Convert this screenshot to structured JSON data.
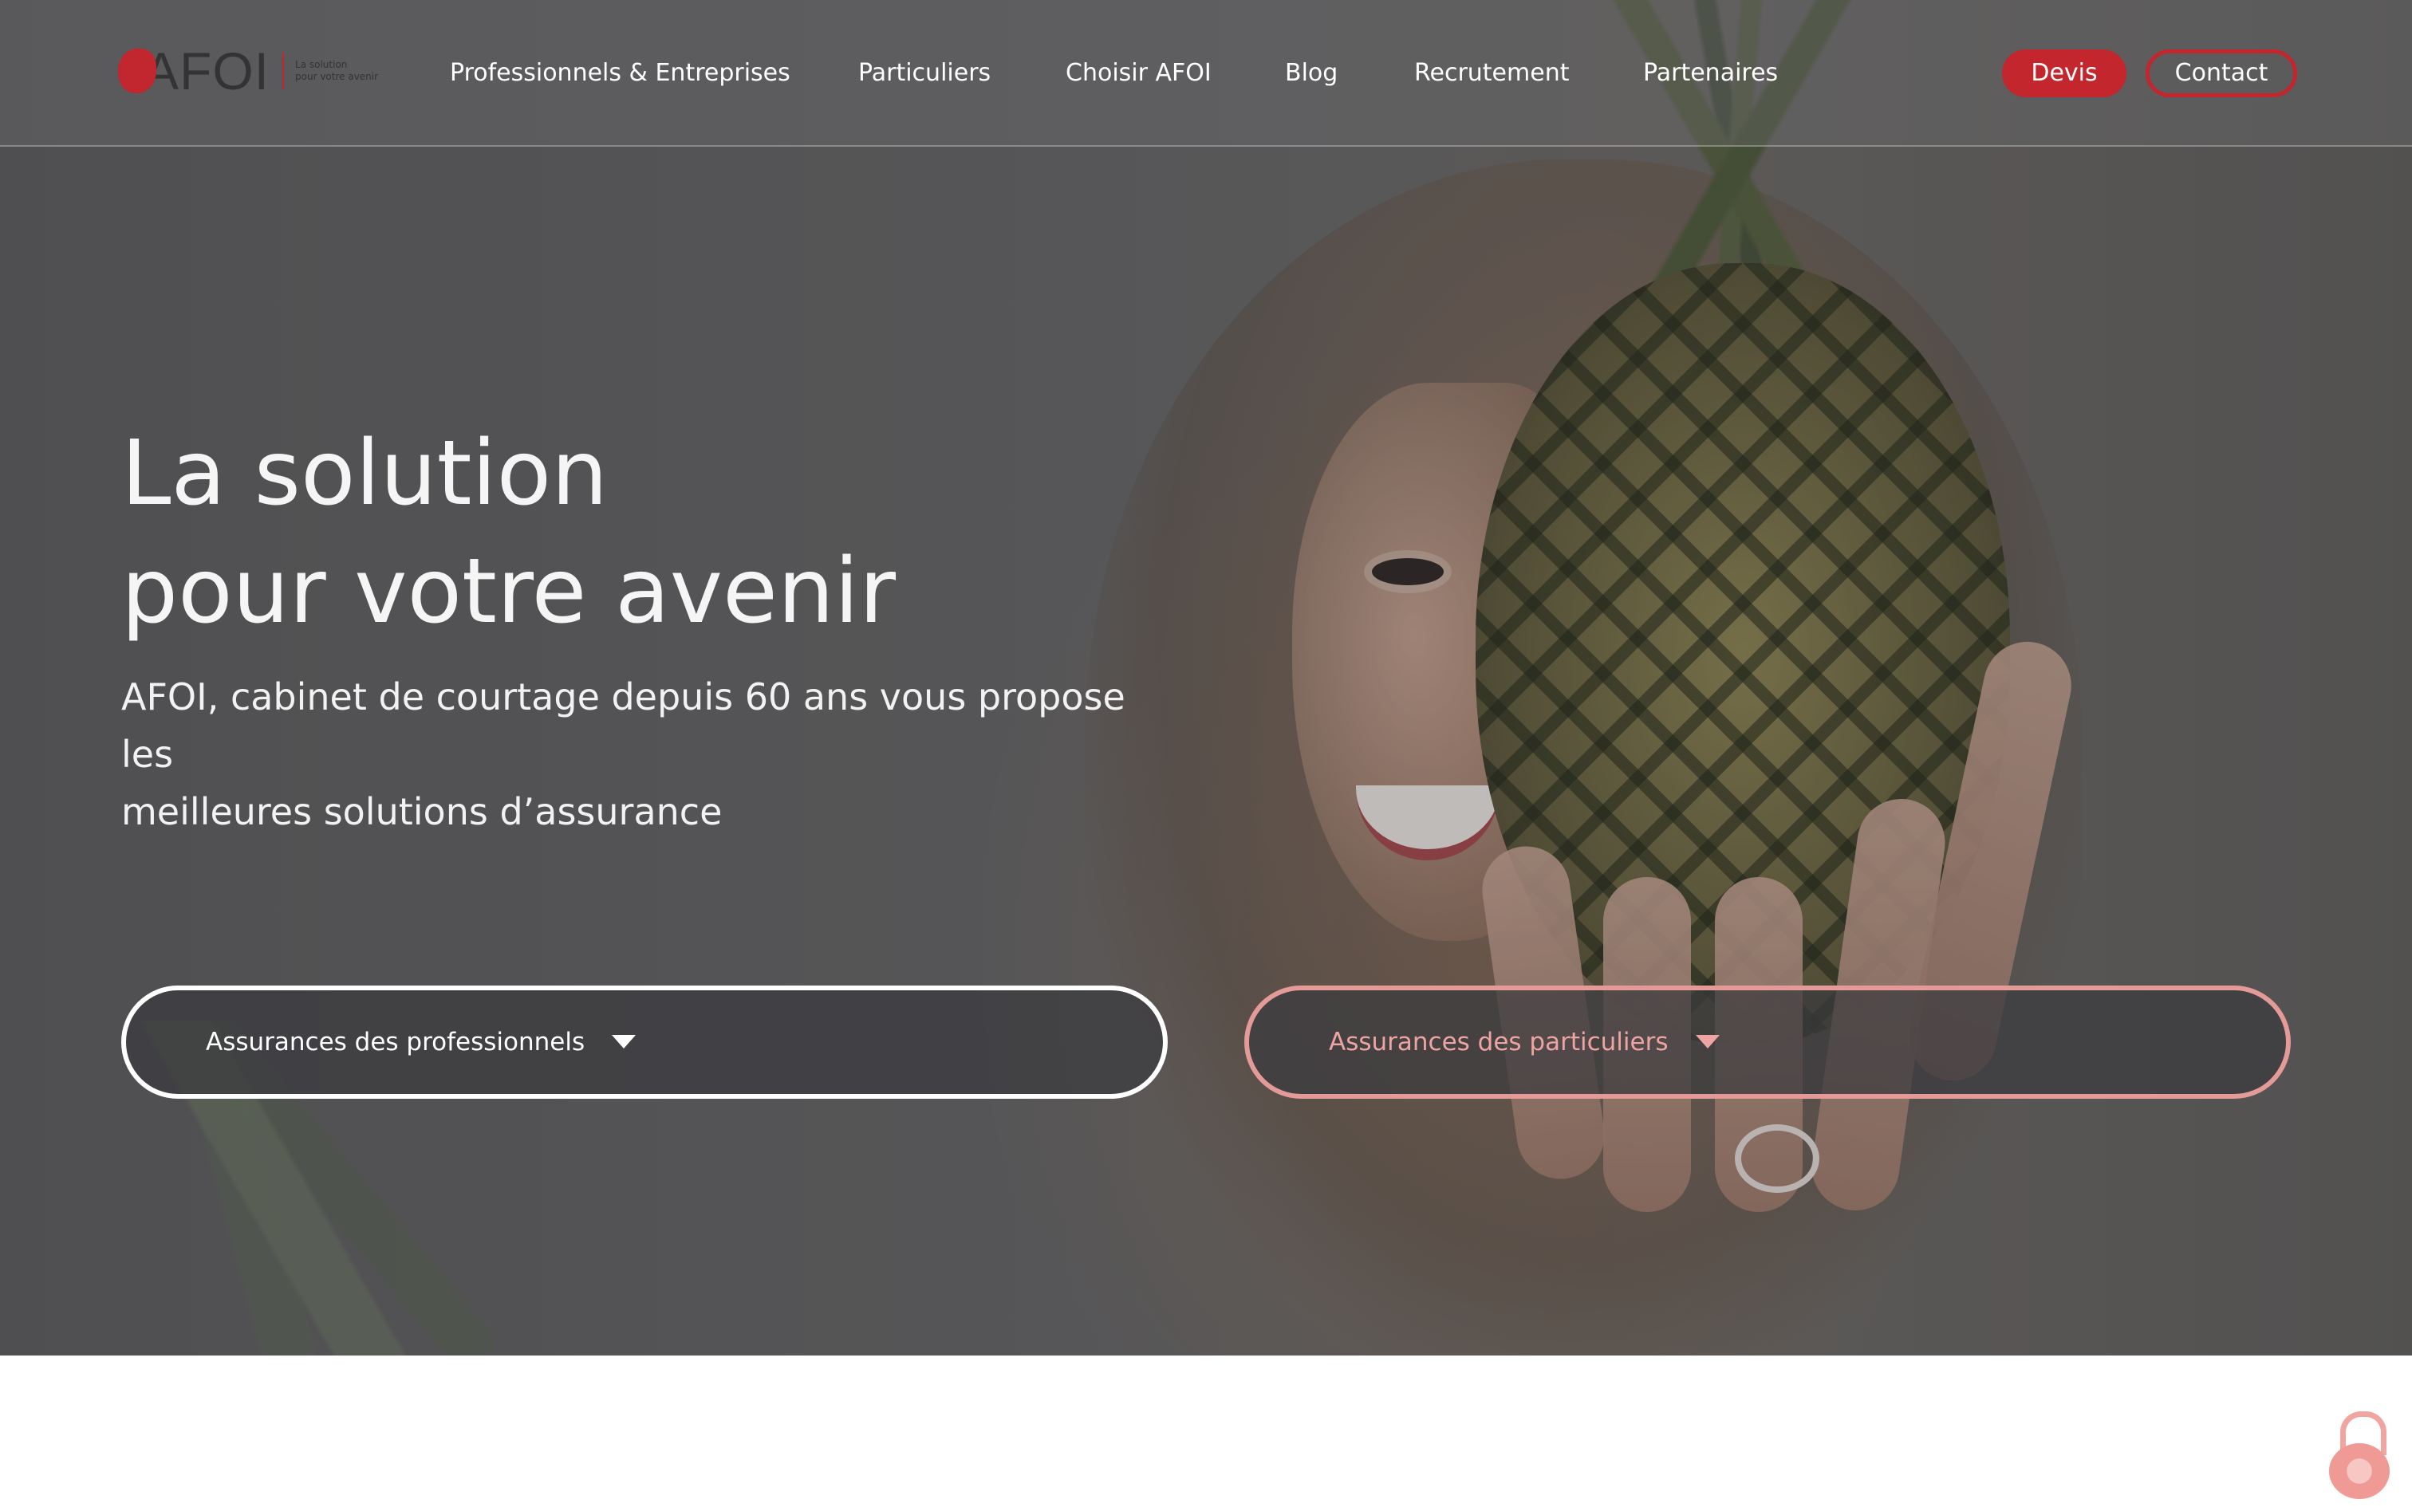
{
  "brand": {
    "logo_text": "AFOI",
    "tagline_line1": "La solution",
    "tagline_line2": "pour votre avenir",
    "accent_color": "#c4262e"
  },
  "nav": {
    "items": [
      {
        "label": "Professionnels & Entreprises"
      },
      {
        "label": "Particuliers"
      },
      {
        "label": "Choisir AFOI"
      },
      {
        "label": "Blog"
      },
      {
        "label": "Recrutement"
      },
      {
        "label": "Partenaires"
      }
    ],
    "devis_label": "Devis",
    "contact_label": "Contact"
  },
  "hero": {
    "title_line1": "La solution",
    "title_line2": "pour votre avenir",
    "subtitle_line1": "AFOI, cabinet de courtage depuis 60 ans vous propose les",
    "subtitle_line2": "meilleures solutions d’assurance"
  },
  "dropdowns": {
    "pro_label": "Assurances des professionnels",
    "part_label": "Assurances des particuliers",
    "pro_color": "#ffffff",
    "part_color": "#e49a97"
  },
  "icons": {
    "dropdown_caret": "caret-down-icon",
    "lock_badge": "lock-icon"
  }
}
